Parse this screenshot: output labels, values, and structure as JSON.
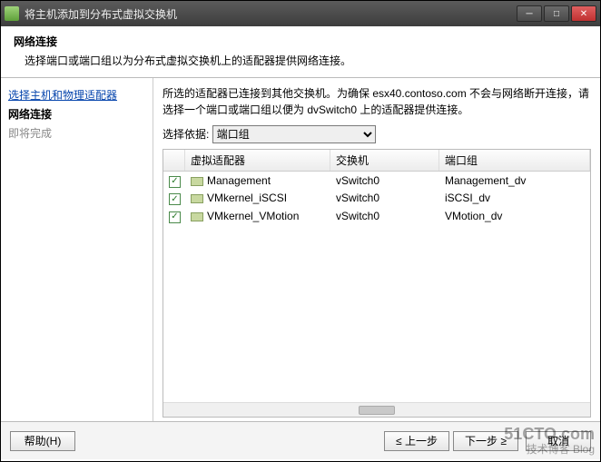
{
  "window": {
    "title": "将主机添加到分布式虚拟交换机"
  },
  "header": {
    "title": "网络连接",
    "subtitle": "选择端口或端口组以为分布式虚拟交换机上的适配器提供网络连接。"
  },
  "sidebar": {
    "step1": "选择主机和物理适配器",
    "step2": "网络连接",
    "step3": "即将完成"
  },
  "content": {
    "info1": "所选的适配器已连接到其他交换机。为确保 esx40.contoso.com 不会与网络断开连接，请选择一个端口或端口组以便为 dvSwitch0 上的适配器提供连接。",
    "selectLabel": "选择依据:",
    "selectValue": "端口组",
    "columns": {
      "adapter": "虚拟适配器",
      "switch": "交换机",
      "portgroup": "端口组"
    },
    "rows": [
      {
        "adapter": "Management",
        "switch": "vSwitch0",
        "portgroup": "Management_dv"
      },
      {
        "adapter": "VMkernel_iSCSI",
        "switch": "vSwitch0",
        "portgroup": "iSCSI_dv"
      },
      {
        "adapter": "VMkernel_VMotion",
        "switch": "vSwitch0",
        "portgroup": "VMotion_dv"
      }
    ]
  },
  "footer": {
    "help": "帮助(H)",
    "back": "≤ 上一步",
    "next": "下一步 ≥",
    "cancel": "取消"
  },
  "watermark": {
    "line1": "51CTO.com",
    "line2": "技术博客 Blog"
  }
}
